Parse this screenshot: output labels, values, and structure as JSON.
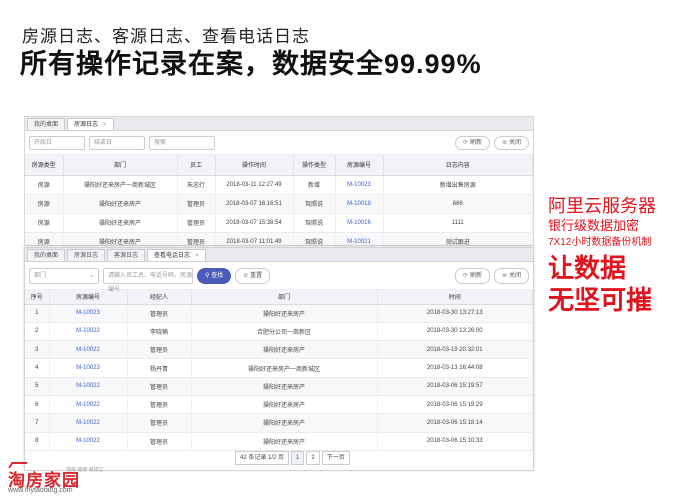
{
  "headline": {
    "sub": "房源日志、客源日志、查看电话日志",
    "main": "所有操作记录在案，数据安全99.99%"
  },
  "house_log": {
    "tabs": [
      {
        "label": "我的桌面",
        "active": false
      },
      {
        "label": "房源日志",
        "active": true,
        "close": "×"
      }
    ],
    "filters": {
      "start_placeholder": "开始日",
      "end_placeholder": "结束日",
      "search_placeholder": "搜索",
      "refresh_label": "刷新",
      "close_label": "关闭"
    },
    "columns": [
      "房源类型",
      "部门",
      "员工",
      "操作时间",
      "操作类型",
      "房源编号",
      "日志内容"
    ],
    "rows": [
      [
        "房源",
        "操阳好还来房产一商新城区",
        "朱忠行",
        "2018-03-11 12:27:49",
        "新增",
        "M-10023",
        "新增出售房源"
      ],
      [
        "房源",
        "操阳好还来房产",
        "管理员",
        "2018-03-07 16:16:51",
        "驾照说",
        "M-10018",
        "666"
      ],
      [
        "房源",
        "操阳好还来房产",
        "管理员",
        "2018-03-07 15:38:54",
        "驾照说",
        "M-10016",
        "1111"
      ],
      [
        "房源",
        "操阳好还来房产",
        "管理员",
        "2018-03-07 11:01:49",
        "驾照说",
        "M-10021",
        "测试跟进"
      ]
    ]
  },
  "phone_log": {
    "tabs": [
      {
        "label": "我的桌面",
        "active": false
      },
      {
        "label": "房源日志",
        "active": false
      },
      {
        "label": "客源日志",
        "active": false
      },
      {
        "label": "查看电话日志",
        "active": true,
        "close": "×"
      }
    ],
    "filters": {
      "dept_placeholder": "部门",
      "keyword_placeholder": "请输入员工名、电话号码、房源编号",
      "search_label": "查找",
      "reset_label": "重置",
      "refresh_label": "刷新",
      "close_label": "关闭"
    },
    "columns": [
      "序号",
      "房源编号",
      "经纪人",
      "部门",
      "时间"
    ],
    "rows": [
      [
        "1",
        "M-10023",
        "管理员",
        "操阳好还来房产",
        "2018-03-30 13:27:13"
      ],
      [
        "2",
        "M-10022",
        "李晓楠",
        "合肥分公司一商新区",
        "2018-03-30 13:26:00"
      ],
      [
        "3",
        "M-10022",
        "管理员",
        "操阳好还来房产",
        "2018-03-19 20:32:01"
      ],
      [
        "4",
        "M-10023",
        "杨丹青",
        "操阳好还来房产一商新城区",
        "2018-03-13 16:44:08"
      ],
      [
        "5",
        "M-10022",
        "管理员",
        "操阳好还来房产",
        "2018-03-06 15:19:57"
      ],
      [
        "6",
        "M-10022",
        "管理员",
        "操阳好还来房产",
        "2018-03-06 15:19:29"
      ],
      [
        "7",
        "M-10022",
        "管理员",
        "操阳好还来房产",
        "2018-03-06 15:18:14"
      ],
      [
        "8",
        "M-10022",
        "管理员",
        "操阳好还来房产",
        "2018-03-06 15:10:33"
      ]
    ],
    "pager": {
      "summary": "42 条记录 1/2 页",
      "page1": "1",
      "page2": "2",
      "next": "下一页"
    }
  },
  "promo": {
    "line1": "阿里云服务器",
    "line2": "银行级数据加密",
    "line3": "7X12小时数据备份机制",
    "line4": "让数据",
    "line5": "无坚可摧"
  },
  "logo": {
    "brand": "淘房家园",
    "tag": "找房 装修 就找它",
    "url": "www.mytaofang.com"
  },
  "colors": {
    "accent_red": "#e0141e",
    "link_blue": "#3a5fc8",
    "search_button": "#4a5bb8"
  }
}
